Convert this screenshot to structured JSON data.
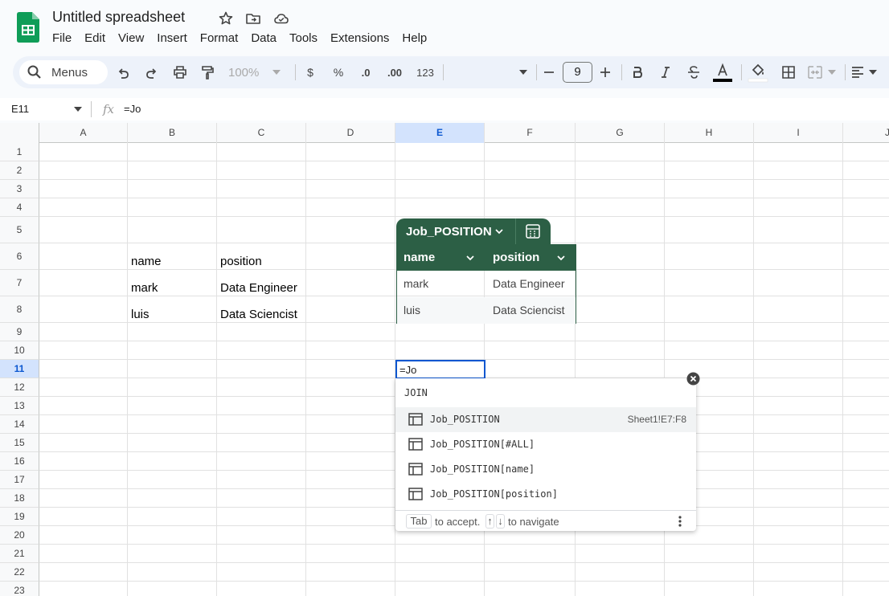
{
  "app": {
    "doc_title": "Untitled spreadsheet",
    "menu": [
      "File",
      "Edit",
      "View",
      "Insert",
      "Format",
      "Data",
      "Tools",
      "Extensions",
      "Help"
    ]
  },
  "toolbar": {
    "search_label": "Menus",
    "zoom": "100%",
    "currency": "$",
    "percent": "%",
    "decrease_decimal": ".0",
    "increase_decimal": ".00",
    "number_format": "123",
    "font_size": "9",
    "accent_color": "#2c5f45"
  },
  "formula_bar": {
    "cell_ref": "E11",
    "fx": "fx",
    "content": "=Jo"
  },
  "grid": {
    "columns": [
      "A",
      "B",
      "C",
      "D",
      "E",
      "F",
      "G",
      "H",
      "I",
      "J"
    ],
    "rows": [
      "1",
      "2",
      "3",
      "4",
      "5",
      "6",
      "7",
      "8",
      "9",
      "10",
      "11",
      "12",
      "13",
      "14",
      "15",
      "16",
      "17",
      "18",
      "19",
      "20",
      "21",
      "22",
      "23"
    ],
    "selected_column": "E",
    "selected_row": "11",
    "cells": {
      "B6": "name",
      "C6": "position",
      "B7": "mark",
      "C7": "Data Engineer",
      "B8": "luis",
      "C8": "Data Sciencist"
    }
  },
  "table_widget": {
    "name": "Job_POSITION",
    "headers": [
      "name",
      "position"
    ],
    "rows": [
      [
        "mark",
        "Data Engineer"
      ],
      [
        "luis",
        "Data Sciencist"
      ]
    ]
  },
  "active_cell": {
    "value": "=Jo"
  },
  "autocomplete": {
    "function": "JOIN",
    "items": [
      {
        "label": "Job_POSITION",
        "range": "Sheet1!E7:F8"
      },
      {
        "label": "Job_POSITION[#ALL]",
        "range": ""
      },
      {
        "label": "Job_POSITION[name]",
        "range": ""
      },
      {
        "label": "Job_POSITION[position]",
        "range": ""
      }
    ],
    "footer": {
      "tab_key": "Tab",
      "accept_text": "to accept.",
      "up_key": "↑",
      "down_key": "↓",
      "navigate_text": "to navigate"
    }
  }
}
